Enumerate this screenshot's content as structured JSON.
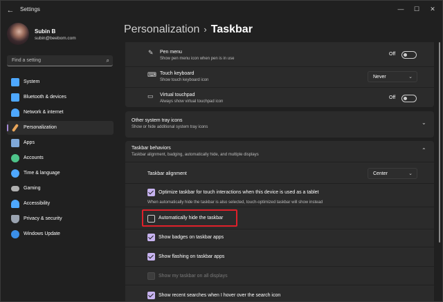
{
  "window": {
    "title": "Settings"
  },
  "profile": {
    "name": "Subin B",
    "email": "subin@beebom.com"
  },
  "search": {
    "placeholder": "Find a setting"
  },
  "nav": {
    "items": [
      {
        "label": "System",
        "icon": "monitor-icon",
        "color": "#4ea8ff"
      },
      {
        "label": "Bluetooth & devices",
        "icon": "bluetooth-icon",
        "color": "#4ea8ff"
      },
      {
        "label": "Network & internet",
        "icon": "wifi-icon",
        "color": "#4ea8ff"
      },
      {
        "label": "Personalization",
        "icon": "brush-icon",
        "color": "#e8a55a"
      },
      {
        "label": "Apps",
        "icon": "apps-icon",
        "color": "#7fa8d8"
      },
      {
        "label": "Accounts",
        "icon": "person-icon",
        "color": "#4ec48a"
      },
      {
        "label": "Time & language",
        "icon": "globe-icon",
        "color": "#4ea8ff"
      },
      {
        "label": "Gaming",
        "icon": "controller-icon",
        "color": "#b0b0b0"
      },
      {
        "label": "Accessibility",
        "icon": "accessibility-icon",
        "color": "#4ea8ff"
      },
      {
        "label": "Privacy & security",
        "icon": "shield-icon",
        "color": "#9aa3b0"
      },
      {
        "label": "Windows Update",
        "icon": "update-icon",
        "color": "#3b8fe8"
      }
    ],
    "active": "Personalization"
  },
  "header": {
    "parent": "Personalization",
    "current": "Taskbar"
  },
  "rows": {
    "pen_menu": {
      "title": "Pen menu",
      "desc": "Show pen menu icon when pen is in use",
      "state": "Off"
    },
    "touch_keyboard": {
      "title": "Touch keyboard",
      "desc": "Show touch keyboard icon",
      "value": "Never"
    },
    "virtual_touchpad": {
      "title": "Virtual touchpad",
      "desc": "Always show virtual touchpad icon",
      "state": "Off"
    },
    "other_tray": {
      "title": "Other system tray icons",
      "desc": "Show or hide additional system tray icons"
    },
    "behaviors": {
      "title": "Taskbar behaviors",
      "desc": "Taskbar alignment, badging, automatically hide, and multiple displays"
    },
    "alignment": {
      "title": "Taskbar alignment",
      "value": "Center"
    }
  },
  "checkboxes": {
    "optimize": {
      "label": "Optimize taskbar for touch interactions when this device is used as a tablet",
      "note": "When automatically hide the taskbar is also selected, touch-optimized taskbar will show instead"
    },
    "autohide": {
      "label": "Automatically hide the taskbar"
    },
    "badges": {
      "label": "Show badges on taskbar apps"
    },
    "flashing": {
      "label": "Show flashing on taskbar apps"
    },
    "all_displays": {
      "label": "Show my taskbar on all displays"
    },
    "recent_searches": {
      "label": "Show recent searches when I hover over the search icon"
    }
  },
  "colors": {
    "accent": "#c7b3f0",
    "highlight": "#e0202a"
  }
}
